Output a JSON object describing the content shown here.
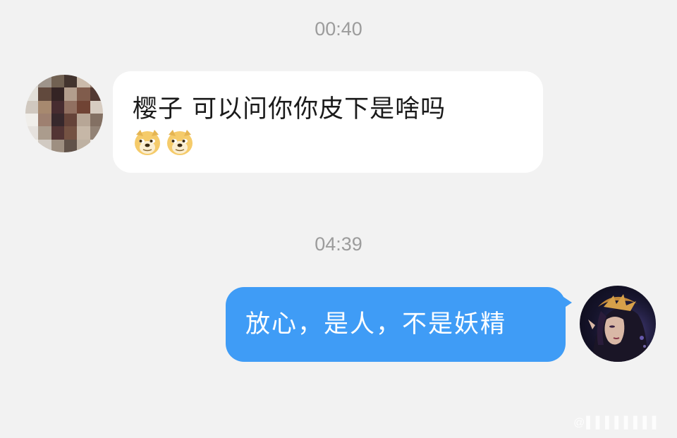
{
  "chat": {
    "messages": [
      {
        "time": "00:40",
        "sender": "incoming",
        "text": "樱子 可以问你你皮下是啥吗",
        "emojis": [
          "doge-emoji",
          "doge-emoji"
        ]
      },
      {
        "time": "04:39",
        "sender": "outgoing",
        "text": "放心，是人，不是妖精"
      }
    ]
  },
  "colors": {
    "background": "#f2f2f2",
    "incoming_bubble": "#ffffff",
    "outgoing_bubble": "#3f9cf6",
    "timestamp_text": "#9c9c9c"
  },
  "avatars": {
    "incoming": "pixelated-avatar",
    "outgoing": "character-portrait-avatar"
  }
}
